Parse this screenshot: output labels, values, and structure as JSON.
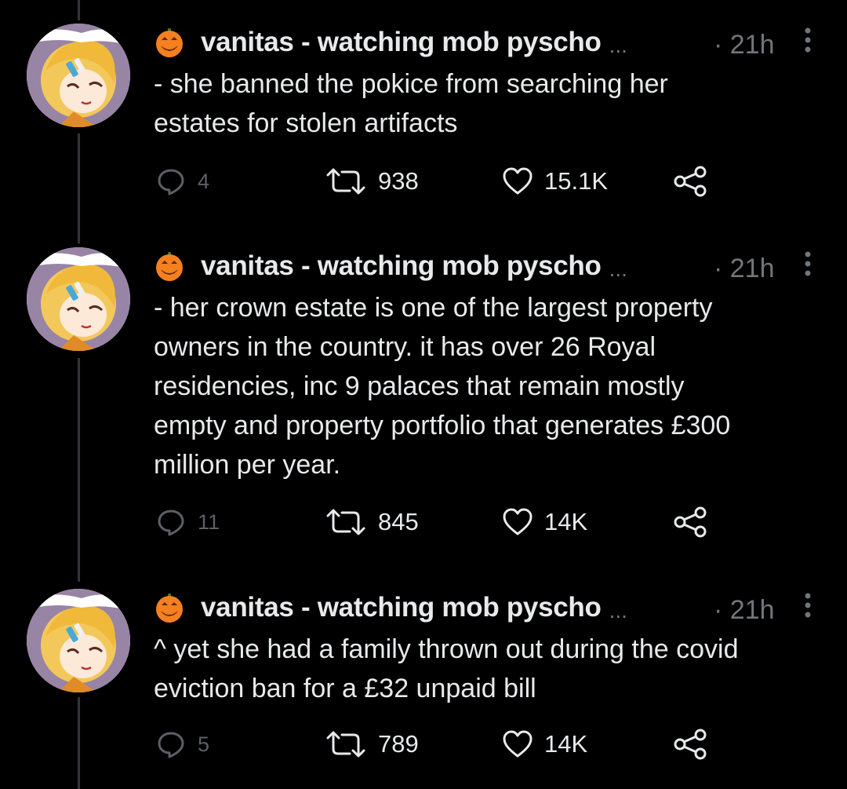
{
  "colors": {
    "background": "#000000",
    "text": "#e7e9ea",
    "muted": "#71767b",
    "thread_line": "#333639",
    "pumpkin": "#f48020"
  },
  "tweets": [
    {
      "display_name": "vanitas - watching mob pyscho",
      "truncation": "...",
      "time": "· 21h",
      "text": "- she banned the pokice from searching her\nestates for stolen artifacts",
      "replies": "4",
      "retweets": "938",
      "likes": "15.1K",
      "icons": [
        "pumpkin-emoji",
        "more-icon",
        "reply-icon",
        "retweet-icon",
        "like-icon",
        "share-icon"
      ]
    },
    {
      "display_name": "vanitas - watching mob pyscho",
      "truncation": "...",
      "time": "· 21h",
      "text": "- her crown estate is one of the largest property\nowners in the country. it has over 26 Royal\nresidencies, inc 9 palaces that remain mostly\nempty and property portfolio that generates £300\nmillion per year.",
      "replies": "11",
      "retweets": "845",
      "likes": "14K",
      "icons": [
        "pumpkin-emoji",
        "more-icon",
        "reply-icon",
        "retweet-icon",
        "like-icon",
        "share-icon"
      ]
    },
    {
      "display_name": "vanitas - watching mob pyscho",
      "truncation": "...",
      "time": "· 21h",
      "text": "^ yet she had a family thrown out during the covid\neviction ban for a £32 unpaid bill",
      "replies": "5",
      "retweets": "789",
      "likes": "14K",
      "icons": [
        "pumpkin-emoji",
        "more-icon",
        "reply-icon",
        "retweet-icon",
        "like-icon",
        "share-icon"
      ]
    }
  ]
}
